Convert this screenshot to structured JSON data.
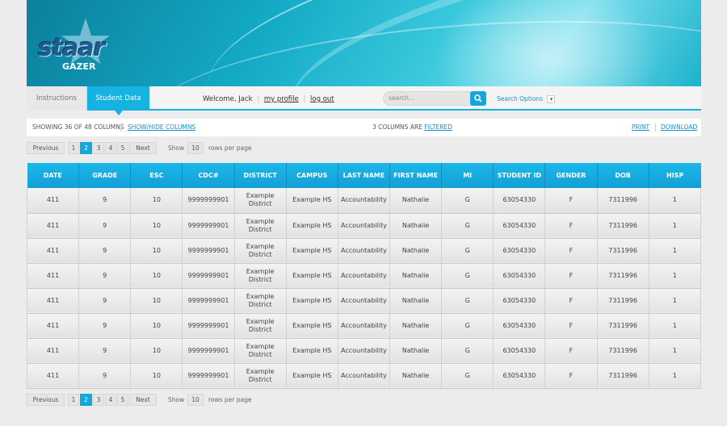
{
  "branding": {
    "logo_text": "staar",
    "logo_sub": "GAZER"
  },
  "nav": {
    "tabs": [
      {
        "label": "Instructions"
      },
      {
        "label": "Student Data"
      }
    ],
    "welcome": "Welcome, Jack",
    "my_profile": "my profile",
    "log_out": "log out",
    "search_placeholder": "search...",
    "search_options": "Search Options"
  },
  "info": {
    "showing": "Showing 36 of 48 columns",
    "show_hide": "Show/Hide Columns",
    "filtered_prefix": "3 columns are",
    "filtered_link": "filtered",
    "print": "Print",
    "download": "Download"
  },
  "pagination": {
    "previous": "Previous",
    "pages": [
      "1",
      "2",
      "3",
      "4",
      "5"
    ],
    "current_page": "2",
    "next": "Next",
    "show": "Show",
    "rows_value": "10",
    "rows_per_page": "rows per page"
  },
  "table": {
    "columns": [
      "DATE",
      "GRADE",
      "ESC",
      "CDC#",
      "DISTRICT",
      "CAMPUS",
      "LAST NAME",
      "FIRST NAME",
      "MI",
      "STUDENT ID",
      "GENDER",
      "DOB",
      "HISP"
    ],
    "rows": [
      [
        "411",
        "9",
        "10",
        "9999999901",
        "Example District",
        "Example HS",
        "Accountability",
        "Nathalie",
        "G",
        "63054330",
        "F",
        "7311996",
        "1"
      ],
      [
        "411",
        "9",
        "10",
        "9999999901",
        "Example District",
        "Example HS",
        "Accountability",
        "Nathalie",
        "G",
        "63054330",
        "F",
        "7311996",
        "1"
      ],
      [
        "411",
        "9",
        "10",
        "9999999901",
        "Example District",
        "Example HS",
        "Accountability",
        "Nathalie",
        "G",
        "63054330",
        "F",
        "7311996",
        "1"
      ],
      [
        "411",
        "9",
        "10",
        "9999999901",
        "Example District",
        "Example HS",
        "Accountability",
        "Nathalie",
        "G",
        "63054330",
        "F",
        "7311996",
        "1"
      ],
      [
        "411",
        "9",
        "10",
        "9999999901",
        "Example District",
        "Example HS",
        "Accountability",
        "Nathalie",
        "G",
        "63054330",
        "F",
        "7311996",
        "1"
      ],
      [
        "411",
        "9",
        "10",
        "9999999901",
        "Example District",
        "Example HS",
        "Accountability",
        "Nathalie",
        "G",
        "63054330",
        "F",
        "7311996",
        "1"
      ],
      [
        "411",
        "9",
        "10",
        "9999999901",
        "Example District",
        "Example HS",
        "Accountability",
        "Nathalie",
        "G",
        "63054330",
        "F",
        "7311996",
        "1"
      ],
      [
        "411",
        "9",
        "10",
        "9999999901",
        "Example District",
        "Example HS",
        "Accountability",
        "Nathalie",
        "G",
        "63054330",
        "F",
        "7311996",
        "1"
      ]
    ]
  },
  "colors": {
    "accent": "#16b2e2",
    "link": "#1a8fc4"
  }
}
